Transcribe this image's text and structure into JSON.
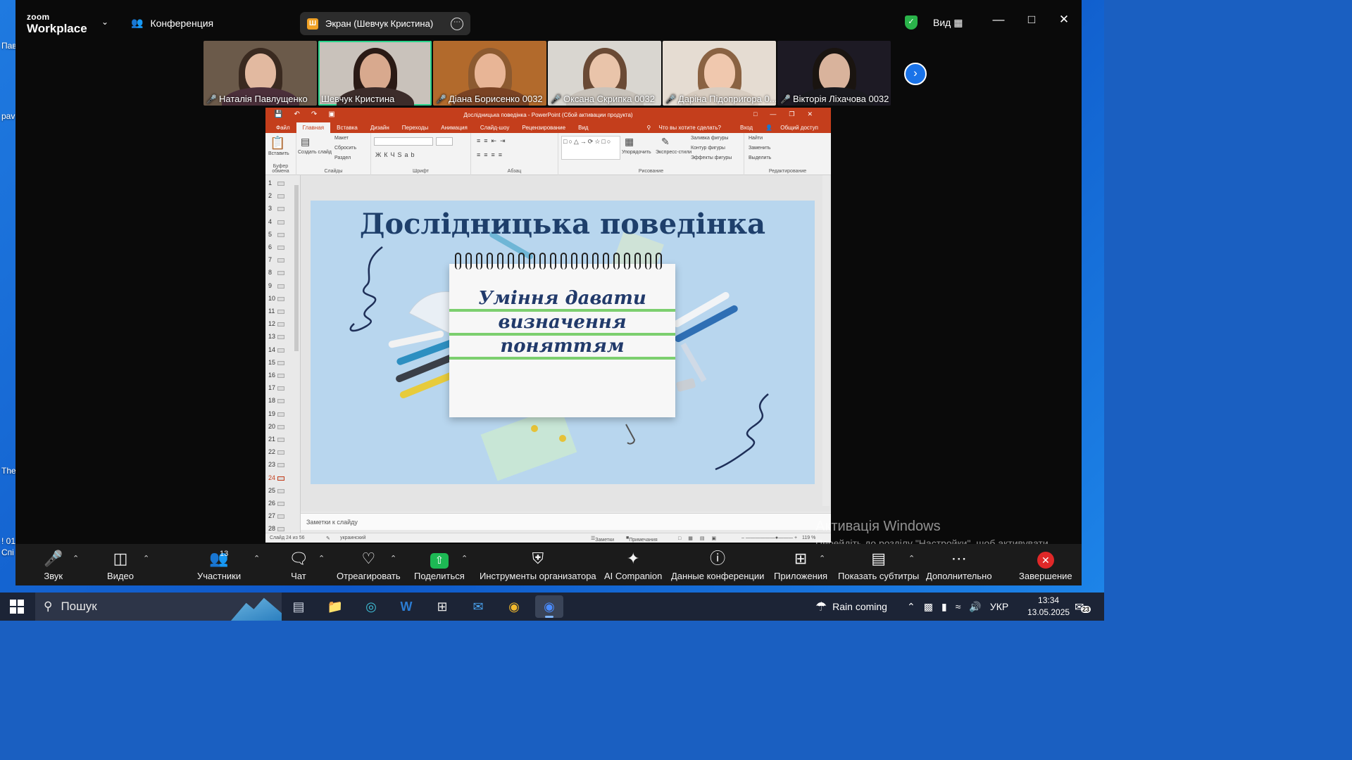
{
  "zoom": {
    "brand_small": "zoom",
    "brand_big": "Workplace",
    "conference_label": "Конференция",
    "screen_share_label": "Экран (Шевчук Кристина)",
    "screen_share_badge": "Ш",
    "view_label": "Вид",
    "participants": [
      {
        "name": "Наталія Павлущенко",
        "muted": true,
        "active": false,
        "bg": "#6b5a4a",
        "skin": "#e2b9a0",
        "hair": "#3a2a20",
        "cloth": "#4b2f3a"
      },
      {
        "name": "Шевчук Кристина",
        "muted": false,
        "active": true,
        "bg": "#c9c2bb",
        "skin": "#d8a98e",
        "hair": "#2a1a15",
        "cloth": "#3c2c2a"
      },
      {
        "name": "Діана Борисенко 0032",
        "muted": true,
        "active": false,
        "bg": "#b26a2c",
        "skin": "#e8b596",
        "hair": "#8c5a30",
        "cloth": "#7a4324"
      },
      {
        "name": "Оксана Скрипка 0032",
        "muted": true,
        "active": false,
        "bg": "#d9d6d0",
        "skin": "#e9c4aa",
        "hair": "#6a4a35",
        "cloth": "#c9c3bb"
      },
      {
        "name": "Даріна Підопригора 0...",
        "muted": true,
        "active": false,
        "bg": "#e5dcd2",
        "skin": "#f0c8ae",
        "hair": "#8a6242",
        "cloth": "#d8cdc1"
      },
      {
        "name": "Вікторія Ліхачова 0032",
        "muted": true,
        "active": false,
        "bg": "#1d1a24",
        "skin": "#d9b39c",
        "hair": "#1a1410",
        "cloth": "#1a1a1f"
      }
    ],
    "toolbar": {
      "audio": "Звук",
      "video": "Видео",
      "participants": "Участники",
      "participants_count": "13",
      "chat": "Чат",
      "react": "Отреагировать",
      "share": "Поделиться",
      "host_tools": "Инструменты организатора",
      "ai": "AI Companion",
      "info": "Данные конференции",
      "apps": "Приложения",
      "captions": "Показать субтитры",
      "more": "Дополнительно",
      "end": "Завершение"
    }
  },
  "ppt": {
    "window_title": "Дослідницька поведінка - PowerPoint (Сбой активации продукта)",
    "tabs": [
      "Файл",
      "Главная",
      "Вставка",
      "Дизайн",
      "Переходы",
      "Анимация",
      "Слайд-шоу",
      "Рецензирование",
      "Вид"
    ],
    "selected_tab": "Главная",
    "tell_me": "Что вы хотите сделать?",
    "signin": "Вход",
    "share": "Общий доступ",
    "ribbon": {
      "paste": "Вставить",
      "clipboard": "Буфер обмена",
      "new_slide": "Создать слайд",
      "layout": "Макет",
      "reset": "Сбросить",
      "section": "Раздел",
      "slides": "Слайды",
      "font": "Шрифт",
      "paragraph": "Абзац",
      "arrange": "Упорядочить",
      "quick_styles": "Экспресс-стили",
      "shape_fill": "Заливка фигуры",
      "shape_outline": "Контур фигуры",
      "shape_effects": "Эффекты фигуры",
      "drawing": "Рисование",
      "find": "Найти",
      "replace": "Заменить",
      "select": "Выделить",
      "editing": "Редактирование"
    },
    "slide_numbers": [
      "1",
      "2",
      "3",
      "4",
      "5",
      "6",
      "7",
      "8",
      "9",
      "10",
      "11",
      "12",
      "13",
      "14",
      "15",
      "16",
      "17",
      "18",
      "19",
      "20",
      "21",
      "22",
      "23",
      "24",
      "25",
      "26",
      "27",
      "28"
    ],
    "current_slide": "24",
    "slide_title": "Дослідницька поведінка",
    "slide_lines": [
      "Уміння давати",
      "визначення",
      "поняттям"
    ],
    "notes_placeholder": "Заметки к слайду",
    "status_slide": "Слайд 24 из 56",
    "status_lang": "украинский",
    "status_notes": "Заметки",
    "status_comments": "Примечания",
    "status_zoom": "119 %"
  },
  "activation": {
    "title": "Активація Windows",
    "body": "Перейдіть до розділу \"Настройки\", щоб активувати Windows."
  },
  "taskbar": {
    "search_label": "Пошук",
    "weather": "Rain coming",
    "lang": "УКР",
    "time": "13:34",
    "date": "13.05.2025",
    "notif_count": "23"
  },
  "desktop_labels": [
    "Пав",
    "pav",
    "The",
    "! 01",
    "Спі"
  ]
}
